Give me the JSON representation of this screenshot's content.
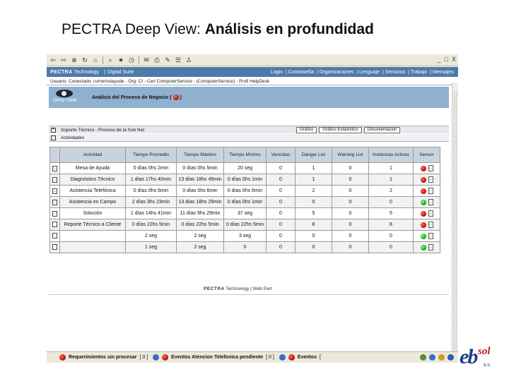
{
  "slide": {
    "title_prefix": "PECTRA Deep View: ",
    "title_bold": "Análisis en profundidad"
  },
  "browser": {
    "toolbar_icons": [
      "back-icon",
      "forward-icon",
      "stop-icon",
      "refresh-icon",
      "home-icon",
      "search-icon",
      "favorites-icon",
      "history-icon",
      "mail-icon",
      "print-icon",
      "edit-icon",
      "discuss-icon",
      "messenger-icon"
    ],
    "window_buttons": [
      "_",
      "□",
      "X"
    ]
  },
  "app": {
    "navbar": {
      "brand": "PECTRA",
      "brand_suffix": "Technology",
      "divider": "|",
      "product": "Digital Suite",
      "links": [
        "Login",
        "| Contraseña",
        "| Organizaciones",
        "| Lenguaje",
        "| Servicios",
        "| Trabajo",
        "| Mensajes"
      ]
    },
    "userbar": "Usuario: Conectado: rurnerisdayude - Org: CI - Ceri ComputerService - (ComputerService) - Profi HelpDesk",
    "header": {
      "logo_text": "Deep View",
      "title": "Análisis del Proceso de Negocio",
      "paren_open": "(",
      "paren_close": ")"
    },
    "sections": {
      "top": {
        "toggle": "+",
        "label": "Soporte Técnico - Proceso de la Sub Net",
        "tabs": [
          "Gráfico",
          "Gráfico Estadístico",
          "Documentación"
        ]
      },
      "actividades": {
        "toggle": "-",
        "label": "Actividades"
      }
    },
    "table": {
      "headers": [
        "",
        "Actividad",
        "Tiempo Promedio",
        "Tiempo Máximo",
        "Tiempo Mínimo",
        "Vencidas",
        "Danger List",
        "Warning List",
        "Instancias Activas",
        "Sensor"
      ],
      "row_button": "...",
      "detail_button": "...",
      "rows": [
        {
          "actividad": "Mesa de Ayuda",
          "promedio": "0 días 0hs 2min",
          "maximo": "0 días 0hs 5min",
          "minimo": "20 seg",
          "vencidas": "0",
          "danger": "1",
          "warning": "0",
          "activas": "1",
          "sensor": "red",
          "has_button": true
        },
        {
          "actividad": "Diagnóstico Técnico",
          "promedio": "1 días 17hs 40min",
          "maximo": "13 días 18hs 49min",
          "minimo": "0 días 0hs 1min",
          "vencidas": "0",
          "danger": "1",
          "warning": "0",
          "activas": "1",
          "sensor": "red",
          "has_button": true
        },
        {
          "actividad": "Asistencia Telefónica",
          "promedio": "0 días 0hs 6min",
          "maximo": "0 días 0hs 6min",
          "minimo": "0 días 0hs 6min",
          "vencidas": "0",
          "danger": "2",
          "warning": "0",
          "activas": "2",
          "sensor": "red",
          "has_button": true
        },
        {
          "actividad": "Asistencia en Campo",
          "promedio": "2 días 3hs 23min",
          "maximo": "13 días 18hs 29min",
          "minimo": "0 días 0hs 1min",
          "vencidas": "0",
          "danger": "0",
          "warning": "0",
          "activas": "0",
          "sensor": "green",
          "has_button": true
        },
        {
          "actividad": "Solución",
          "promedio": "1 días 14hs 41min",
          "maximo": "11 días 9hs 29min",
          "minimo": "37 seg",
          "vencidas": "0",
          "danger": "5",
          "warning": "0",
          "activas": "5",
          "sensor": "red",
          "has_button": true
        },
        {
          "actividad": "Reporte Técnico a Cliente",
          "promedio": "0 días 22hs 5min",
          "maximo": "0 días 22hs 5min",
          "minimo": "0 días 22hs 5min",
          "vencidas": "0",
          "danger": "8",
          "warning": "0",
          "activas": "8",
          "sensor": "red",
          "has_button": false
        },
        {
          "actividad": "",
          "promedio": "2 seg",
          "maximo": "2 seg",
          "minimo": "3 seg",
          "vencidas": "0",
          "danger": "0",
          "warning": "0",
          "activas": "0",
          "sensor": "green",
          "has_button": false
        },
        {
          "actividad": "",
          "promedio": "1 seg",
          "maximo": "2 seg",
          "minimo": "0",
          "vencidas": "0",
          "danger": "0",
          "warning": "0",
          "activas": "0",
          "sensor": "green",
          "has_button": false
        }
      ]
    },
    "footer": {
      "brand": "PECTRA",
      "brand_suffix": "Technology",
      "product": "| Web Part"
    }
  },
  "statusbar": {
    "items": [
      {
        "label": "Requerimientos sin procesar",
        "value": "[ 0 ]",
        "color": "red"
      },
      {
        "label": "Eventos Atencion Telefonica pendiente",
        "value": "[ 0 ]",
        "color": "red"
      },
      {
        "label": "Eventos",
        "value": "[",
        "color": "red"
      }
    ],
    "tray_icons": [
      "network-icon",
      "speaker-icon",
      "shield-icon",
      "clock-icon"
    ]
  },
  "corner_logo": {
    "eb": "eb",
    "sol": "sol",
    "suffix": "s.c."
  },
  "colors": {
    "nav_blue": "#4d7aa8",
    "header_blue": "#8fb0cf",
    "sensor_red": "#c1100b",
    "sensor_green": "#12a712",
    "logo_blue": "#1f3f8a",
    "logo_red": "#c01a1a"
  }
}
